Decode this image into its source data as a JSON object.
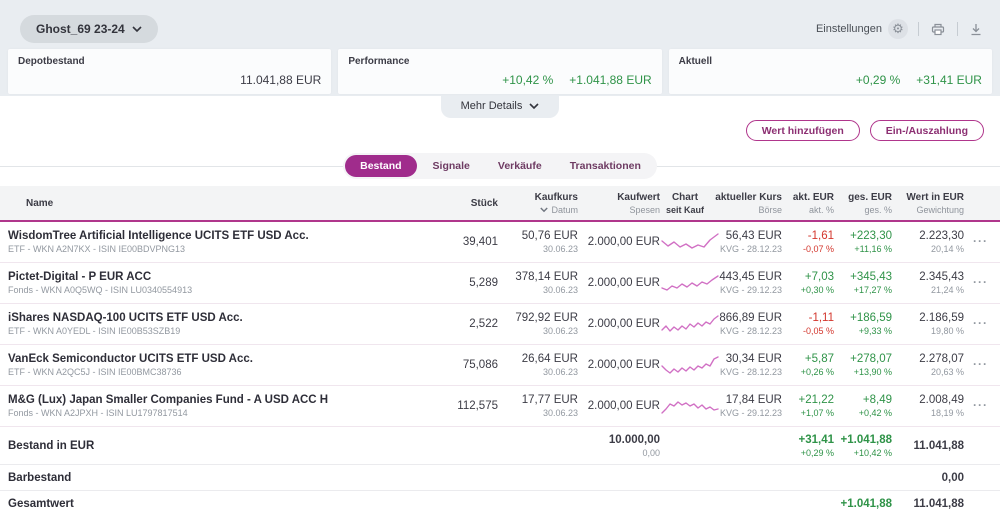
{
  "topbar": {
    "depot_name": "Ghost_69 23-24",
    "settings_label": "Einstellungen",
    "gear_glyph": "⚙"
  },
  "cards": {
    "depot": {
      "label": "Depotbestand",
      "value": "11.041,88 EUR"
    },
    "performance": {
      "label": "Performance",
      "pct": "+10,42 %",
      "value": "+1.041,88 EUR"
    },
    "aktuell": {
      "label": "Aktuell",
      "pct": "+0,29 %",
      "value": "+31,41 EUR"
    }
  },
  "more_details_label": "Mehr Details",
  "actions": {
    "add_value": "Wert hinzufügen",
    "payment": "Ein-/Auszahlung"
  },
  "tabs": {
    "bestand": "Bestand",
    "signale": "Signale",
    "verkaeufe": "Verkäufe",
    "transaktionen": "Transaktionen"
  },
  "table": {
    "head": {
      "name": "Name",
      "stueck": "Stück",
      "kaufkurs": "Kaufkurs",
      "kaufkurs_sub": "Datum",
      "kaufwert": "Kaufwert",
      "kaufwert_sub": "Spesen",
      "chart": "Chart",
      "chart_sub": "seit Kauf",
      "kurs": "aktueller Kurs",
      "kurs_sub": "Börse",
      "akt": "akt. EUR",
      "akt_sub": "akt. %",
      "ges": "ges. EUR",
      "ges_sub": "ges. %",
      "wert": "Wert in EUR",
      "wert_sub": "Gewichtung"
    },
    "more_glyph": "···",
    "rows": [
      {
        "name": "WisdomTree Artificial Intelligence UCITS ETF USD Acc.",
        "sub": "ETF - WKN A2N7KX - ISIN IE00BDVPNG13",
        "stueck": "39,401",
        "kaufkurs": "50,76 EUR",
        "datum": "30.06.23",
        "kaufwert": "2.000,00 EUR",
        "kurs": "56,43 EUR",
        "boerse": "KVG - 28.12.23",
        "akt": "-1,61",
        "akt_pct": "-0,07 %",
        "akt_dir": "neg",
        "ges": "+223,30",
        "ges_pct": "+11,16 %",
        "ges_dir": "pos",
        "wert": "2.223,30",
        "gewicht": "20,14 %",
        "spark": "2,9 8,14 14,10 20,15 26,12 32,16 38,13 44,15 50,8 58,2"
      },
      {
        "name": "Pictet-Digital - P EUR ACC",
        "sub": "Fonds - WKN A0Q5WQ - ISIN LU0340554913",
        "stueck": "5,289",
        "kaufkurs": "378,14 EUR",
        "datum": "30.06.23",
        "kaufwert": "2.000,00 EUR",
        "kurs": "443,45 EUR",
        "boerse": "KVG - 29.12.23",
        "akt": "+7,03",
        "akt_pct": "+0,30 %",
        "akt_dir": "pos",
        "ges": "+345,43",
        "ges_pct": "+17,27 %",
        "ges_dir": "pos",
        "wert": "2.345,43",
        "gewicht": "21,24 %",
        "spark": "2,15 7,17 12,13 17,15 22,11 27,14 32,10 37,13 42,9 47,11 52,7 58,3"
      },
      {
        "name": "iShares NASDAQ-100 UCITS ETF USD Acc.",
        "sub": "ETF - WKN A0YEDL - ISIN IE00B53SZB19",
        "stueck": "2,522",
        "kaufkurs": "792,92 EUR",
        "datum": "30.06.23",
        "kaufwert": "2.000,00 EUR",
        "kurs": "866,89 EUR",
        "boerse": "KVG - 28.12.23",
        "akt": "-1,11",
        "akt_pct": "-0,05 %",
        "akt_dir": "neg",
        "ges": "+186,59",
        "ges_pct": "+9,33 %",
        "ges_dir": "pos",
        "wert": "2.186,59",
        "gewicht": "19,80 %",
        "spark": "2,16 6,12 10,17 14,13 18,16 22,12 26,15 30,10 34,13 38,9 42,12 46,8 50,10 54,5 58,2"
      },
      {
        "name": "VanEck Semiconductor UCITS ETF USD Acc.",
        "sub": "ETF - WKN A2QC5J - ISIN IE00BMC38736",
        "stueck": "75,086",
        "kaufkurs": "26,64 EUR",
        "datum": "30.06.23",
        "kaufwert": "2.000,00 EUR",
        "kurs": "30,34 EUR",
        "boerse": "KVG - 28.12.23",
        "akt": "+5,87",
        "akt_pct": "+0,26 %",
        "akt_dir": "pos",
        "ges": "+278,07",
        "ges_pct": "+13,90 %",
        "ges_dir": "pos",
        "wert": "2.278,07",
        "gewicht": "20,63 %",
        "spark": "2,11 6,15 10,18 14,14 18,17 22,13 26,16 30,12 34,15 38,11 42,13 46,9 50,11 54,4 58,2"
      },
      {
        "name": "M&G (Lux) Japan Smaller Companies Fund - A USD ACC H",
        "sub": "Fonds - WKN A2JPXH - ISIN LU1797817514",
        "stueck": "112,575",
        "kaufkurs": "17,77 EUR",
        "datum": "30.06.23",
        "kaufwert": "2.000,00 EUR",
        "kurs": "17,84 EUR",
        "boerse": "KVG - 29.12.23",
        "akt": "+21,22",
        "akt_pct": "+1,07 %",
        "akt_dir": "pos",
        "ges": "+8,49",
        "ges_pct": "+0,42 %",
        "ges_dir": "pos",
        "wert": "2.008,49",
        "gewicht": "18,19 %",
        "spark": "2,17 6,13 10,8 14,10 18,6 22,9 26,7 30,10 34,8 38,12 42,9 46,13 50,11 54,14 58,13"
      }
    ],
    "summary": {
      "bestand": {
        "label": "Bestand in EUR",
        "kaufwert": "10.000,00",
        "spesen": "0,00",
        "akt": "+31,41",
        "akt_pct": "+0,29 %",
        "ges": "+1.041,88",
        "ges_pct": "+10,42 %",
        "wert": "11.041,88"
      },
      "barbestand": {
        "label": "Barbestand",
        "wert": "0,00"
      },
      "gesamt": {
        "label": "Gesamtwert",
        "ges": "+1.041,88",
        "wert": "11.041,88"
      }
    }
  }
}
